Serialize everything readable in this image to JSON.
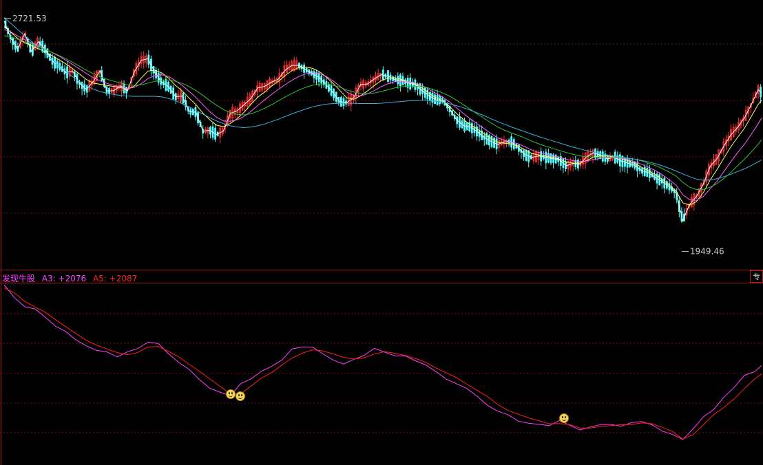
{
  "colors": {
    "background": "#000000",
    "grid": "#7a1010",
    "frame": "#a02020",
    "candle_up": "#ff3030",
    "candle_down": "#54ffff",
    "ma_white": "#ffffff",
    "ma_yellow": "#ffff60",
    "ma_magenta": "#ff60ff",
    "ma_green": "#30c030",
    "ma_blue": "#3cb0e0",
    "a3_color": "#ff40ff",
    "a5_color": "#ff2020",
    "title_color": "#ff40ff",
    "marker_color": "#f3d35a"
  },
  "price_panel": {
    "high_label": "2721.53",
    "low_label": "1949.46"
  },
  "indicator_panel": {
    "name": "发现牛股",
    "a3_text": "A3: +2076",
    "a5_text": "A5: +2087",
    "side_tab": "专"
  },
  "chart_data": [
    {
      "type": "line",
      "subtype": "candlestick-with-moving-averages",
      "title": "",
      "xlabel": "",
      "ylabel": "",
      "ylim": [
        1900,
        2760
      ],
      "annotations": [
        {
          "label": "2721.53",
          "value": 2721.53
        },
        {
          "label": "1949.46",
          "value": 1949.46
        }
      ],
      "x": [
        0,
        10,
        20,
        30,
        40,
        50,
        60,
        70,
        80,
        90,
        100,
        110,
        120,
        130,
        140,
        150,
        160,
        170,
        180,
        190,
        200,
        210,
        220,
        230,
        240,
        250,
        260,
        270,
        280,
        290,
        300,
        310,
        320,
        330,
        340,
        350,
        360,
        370,
        380,
        390,
        400,
        410,
        420,
        430,
        440,
        450,
        460,
        470,
        480,
        490,
        500,
        510,
        520,
        530,
        540,
        550,
        560,
        570,
        580,
        590,
        600,
        610,
        620,
        630,
        640,
        650,
        660,
        670,
        680,
        690,
        700,
        710,
        720,
        730,
        740,
        750,
        760,
        770,
        780,
        790,
        800,
        810,
        820,
        830,
        840,
        850,
        860,
        870,
        880,
        890,
        900,
        910,
        920,
        930,
        940,
        950,
        960,
        970,
        980,
        990,
        1000,
        1010,
        1020,
        1030,
        1040,
        1050,
        1060,
        1070,
        1080,
        1090,
        1100,
        1105
      ],
      "series": [
        {
          "values": [
            2708,
            2650,
            2616,
            2666,
            2608,
            2640,
            2614,
            2576,
            2560,
            2537,
            2542,
            2502,
            2481,
            2507,
            2543,
            2476,
            2477,
            2493,
            2476,
            2540,
            2578,
            2583,
            2537,
            2505,
            2490,
            2457,
            2459,
            2407,
            2405,
            2342,
            2345,
            2331,
            2343,
            2401,
            2410,
            2430,
            2451,
            2486,
            2491,
            2505,
            2515,
            2545,
            2561,
            2561,
            2546,
            2533,
            2520,
            2496,
            2470,
            2440,
            2437,
            2454,
            2497,
            2499,
            2516,
            2530,
            2525,
            2513,
            2511,
            2502,
            2496,
            2477,
            2460,
            2446,
            2445,
            2416,
            2380,
            2361,
            2356,
            2341,
            2322,
            2309,
            2298,
            2307,
            2306,
            2287,
            2263,
            2255,
            2260,
            2255,
            2251,
            2247,
            2227,
            2235,
            2232,
            2258,
            2270,
            2262,
            2250,
            2256,
            2243,
            2236,
            2229,
            2211,
            2204,
            2188,
            2175,
            2158,
            2138,
            2044,
            2099,
            2125,
            2166,
            2225,
            2251,
            2293,
            2329,
            2355,
            2386,
            2431,
            2480,
            2469
          ]
        },
        {
          "values": [
            2690,
            2670,
            2650,
            2636,
            2626,
            2616,
            2606,
            2593,
            2580,
            2566,
            2550,
            2532,
            2514,
            2502,
            2498,
            2494,
            2491,
            2487,
            2482,
            2492,
            2519,
            2542,
            2545,
            2536,
            2518,
            2494,
            2476,
            2452,
            2430,
            2402,
            2380,
            2362,
            2357,
            2368,
            2384,
            2405,
            2431,
            2455,
            2472,
            2492,
            2508,
            2527,
            2544,
            2554,
            2555,
            2551,
            2540,
            2522,
            2501,
            2477,
            2453,
            2448,
            2460,
            2476,
            2494,
            2510,
            2518,
            2520,
            2514,
            2506,
            2498,
            2486,
            2468,
            2453,
            2443,
            2424,
            2401,
            2381,
            2364,
            2350,
            2334,
            2318,
            2305,
            2302,
            2299,
            2293,
            2280,
            2268,
            2263,
            2259,
            2255,
            2249,
            2240,
            2236,
            2236,
            2245,
            2256,
            2260,
            2260,
            2256,
            2251,
            2244,
            2235,
            2222,
            2210,
            2198,
            2182,
            2164,
            2144,
            2104,
            2096,
            2108,
            2138,
            2180,
            2215,
            2253,
            2290,
            2322,
            2352,
            2391,
            2431,
            2446
          ]
        },
        {
          "values": [
            2680,
            2672,
            2658,
            2646,
            2636,
            2626,
            2615,
            2603,
            2592,
            2578,
            2564,
            2549,
            2534,
            2520,
            2509,
            2501,
            2495,
            2489,
            2484,
            2488,
            2500,
            2517,
            2527,
            2530,
            2524,
            2510,
            2494,
            2474,
            2454,
            2430,
            2407,
            2388,
            2376,
            2375,
            2380,
            2391,
            2408,
            2428,
            2446,
            2464,
            2481,
            2497,
            2512,
            2524,
            2533,
            2536,
            2533,
            2524,
            2509,
            2491,
            2472,
            2461,
            2460,
            2466,
            2477,
            2490,
            2500,
            2507,
            2508,
            2506,
            2502,
            2494,
            2481,
            2467,
            2455,
            2439,
            2420,
            2401,
            2383,
            2367,
            2351,
            2335,
            2320,
            2312,
            2306,
            2300,
            2290,
            2279,
            2271,
            2266,
            2261,
            2256,
            2249,
            2244,
            2241,
            2243,
            2248,
            2252,
            2254,
            2254,
            2252,
            2248,
            2241,
            2232,
            2222,
            2211,
            2197,
            2181,
            2163,
            2131,
            2114,
            2112,
            2125,
            2150,
            2176,
            2208,
            2240,
            2271,
            2299,
            2332,
            2367,
            2386
          ]
        },
        {
          "values": [
            2660,
            2655,
            2648,
            2640,
            2632,
            2624,
            2614,
            2604,
            2594,
            2583,
            2571,
            2558,
            2545,
            2533,
            2523,
            2515,
            2508,
            2502,
            2496,
            2494,
            2496,
            2502,
            2508,
            2512,
            2512,
            2508,
            2501,
            2490,
            2477,
            2461,
            2444,
            2428,
            2414,
            2404,
            2398,
            2396,
            2400,
            2408,
            2418,
            2430,
            2443,
            2456,
            2468,
            2479,
            2488,
            2495,
            2499,
            2499,
            2495,
            2488,
            2479,
            2472,
            2468,
            2467,
            2469,
            2474,
            2480,
            2486,
            2490,
            2492,
            2492,
            2490,
            2485,
            2477,
            2469,
            2458,
            2445,
            2430,
            2415,
            2400,
            2385,
            2370,
            2356,
            2345,
            2336,
            2328,
            2319,
            2309,
            2300,
            2292,
            2285,
            2278,
            2271,
            2265,
            2260,
            2257,
            2256,
            2256,
            2256,
            2255,
            2254,
            2252,
            2249,
            2243,
            2236,
            2228,
            2218,
            2206,
            2193,
            2172,
            2156,
            2148,
            2148,
            2156,
            2168,
            2185,
            2205,
            2227,
            2249,
            2273,
            2299,
            2314
          ]
        },
        {
          "values": [
            2720,
            2700,
            2680,
            2660,
            2640,
            2620,
            2600,
            2580,
            2560,
            2541,
            2523,
            2507,
            2493,
            2482,
            2474,
            2468,
            2464,
            2461,
            2459,
            2458,
            2458,
            2458,
            2458,
            2456,
            2451,
            2444,
            2434,
            2423,
            2411,
            2399,
            2387,
            2376,
            2367,
            2360,
            2356,
            2354,
            2356,
            2360,
            2366,
            2374,
            2382,
            2391,
            2400,
            2408,
            2416,
            2423,
            2428,
            2432,
            2434,
            2435,
            2435,
            2435,
            2434,
            2434,
            2434,
            2435,
            2437,
            2439,
            2441,
            2443,
            2444,
            2445,
            2444,
            2442,
            2438,
            2433,
            2427,
            2420,
            2412,
            2403,
            2394,
            2384,
            2374,
            2365,
            2356,
            2348,
            2340,
            2332,
            2324,
            2317,
            2310,
            2303,
            2296,
            2289,
            2283,
            2277,
            2272,
            2267,
            2263,
            2259,
            2256,
            2253,
            2249,
            2245,
            2240,
            2234,
            2227,
            2219,
            2210,
            2200,
            2191,
            2183,
            2179,
            2180,
            2184,
            2191,
            2199,
            2208,
            2217,
            2228,
            2240,
            2247
          ]
        }
      ]
    },
    {
      "type": "line",
      "title": "",
      "xlabel": "",
      "ylabel": "",
      "ylim": [
        1880,
        2720
      ],
      "x": [
        0,
        15,
        30,
        45,
        60,
        75,
        90,
        105,
        120,
        135,
        150,
        165,
        180,
        195,
        210,
        225,
        240,
        255,
        270,
        285,
        300,
        315,
        330,
        345,
        360,
        375,
        390,
        405,
        420,
        435,
        450,
        465,
        480,
        495,
        510,
        525,
        540,
        555,
        570,
        585,
        600,
        615,
        630,
        645,
        660,
        675,
        690,
        705,
        720,
        735,
        750,
        765,
        780,
        795,
        810,
        825,
        840,
        855,
        870,
        885,
        900,
        915,
        930,
        945,
        960,
        975,
        990,
        1005,
        1020,
        1035,
        1050,
        1065,
        1080,
        1095,
        1105
      ],
      "series": [
        {
          "name": "A3",
          "values": [
            2714,
            2654,
            2612,
            2602,
            2564,
            2522,
            2497,
            2458,
            2431,
            2410,
            2403,
            2380,
            2404,
            2419,
            2448,
            2442,
            2394,
            2354,
            2322,
            2275,
            2235,
            2217,
            2200,
            2256,
            2278,
            2313,
            2336,
            2365,
            2417,
            2426,
            2425,
            2394,
            2366,
            2347,
            2368,
            2387,
            2420,
            2402,
            2385,
            2385,
            2362,
            2343,
            2312,
            2277,
            2256,
            2234,
            2198,
            2156,
            2129,
            2113,
            2083,
            2073,
            2068,
            2062,
            2086,
            2064,
            2042,
            2056,
            2067,
            2068,
            2059,
            2076,
            2081,
            2066,
            2037,
            2021,
            1998,
            2047,
            2103,
            2136,
            2194,
            2239,
            2295,
            2312,
            2340
          ]
        },
        {
          "name": "A5",
          "values": [
            2700,
            2676,
            2637,
            2611,
            2587,
            2552,
            2520,
            2487,
            2457,
            2434,
            2417,
            2400,
            2390,
            2401,
            2426,
            2428,
            2405,
            2380,
            2346,
            2313,
            2278,
            2244,
            2207,
            2209,
            2245,
            2281,
            2307,
            2342,
            2375,
            2397,
            2413,
            2408,
            2394,
            2378,
            2370,
            2376,
            2393,
            2404,
            2397,
            2387,
            2373,
            2355,
            2329,
            2306,
            2284,
            2254,
            2225,
            2197,
            2160,
            2132,
            2115,
            2098,
            2085,
            2071,
            2072,
            2067,
            2051,
            2051,
            2058,
            2062,
            2066,
            2067,
            2075,
            2071,
            2054,
            2035,
            2000,
            2020,
            2066,
            2113,
            2146,
            2186,
            2234,
            2279,
            2301
          ]
        }
      ],
      "markers": [
        {
          "type": "smiley-icon",
          "x": 330,
          "value": 2208
        },
        {
          "type": "smiley-icon",
          "x": 345,
          "value": 2198
        },
        {
          "type": "smiley-icon",
          "x": 817,
          "value": 2096
        }
      ]
    }
  ]
}
